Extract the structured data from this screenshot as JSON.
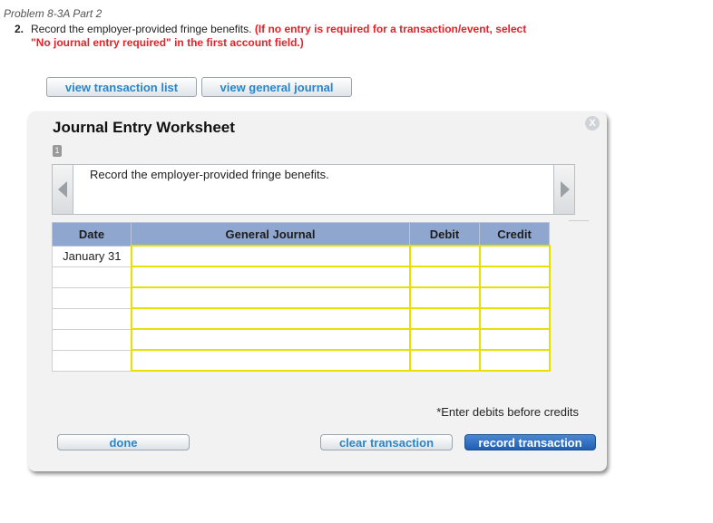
{
  "problem": {
    "title": "Problem 8-3A Part 2"
  },
  "instruction": {
    "number": "2.",
    "text": "Record the employer-provided fringe benefits.",
    "note_line1": "(If no entry is required for a transaction/event, select",
    "note_line2": "\"No journal entry required\" in the first account field.)"
  },
  "top_buttons": {
    "view_transactions": "view transaction list",
    "view_journal": "view general journal"
  },
  "worksheet": {
    "title": "Journal Entry Worksheet",
    "close": "X",
    "page_badge": "1",
    "description": "Record the employer-provided fringe benefits.",
    "columns": {
      "date": "Date",
      "general_journal": "General Journal",
      "debit": "Debit",
      "credit": "Credit"
    },
    "rows": [
      {
        "date": "January 31",
        "account": "",
        "debit": "",
        "credit": ""
      },
      {
        "date": "",
        "account": "",
        "debit": "",
        "credit": ""
      },
      {
        "date": "",
        "account": "",
        "debit": "",
        "credit": ""
      },
      {
        "date": "",
        "account": "",
        "debit": "",
        "credit": ""
      },
      {
        "date": "",
        "account": "",
        "debit": "",
        "credit": ""
      },
      {
        "date": "",
        "account": "",
        "debit": "",
        "credit": ""
      }
    ],
    "footnote": "*Enter debits before credits"
  },
  "bottom_buttons": {
    "done": "done",
    "clear": "clear transaction",
    "record": "record transaction"
  },
  "icons": {
    "prev": "chevron-left-icon",
    "next": "chevron-right-icon",
    "close": "close-icon"
  },
  "colors": {
    "header_blue": "#8fa7cf",
    "input_yellow": "#e8e000",
    "alert_red": "#e8202a",
    "link_blue": "#2a86c9"
  }
}
